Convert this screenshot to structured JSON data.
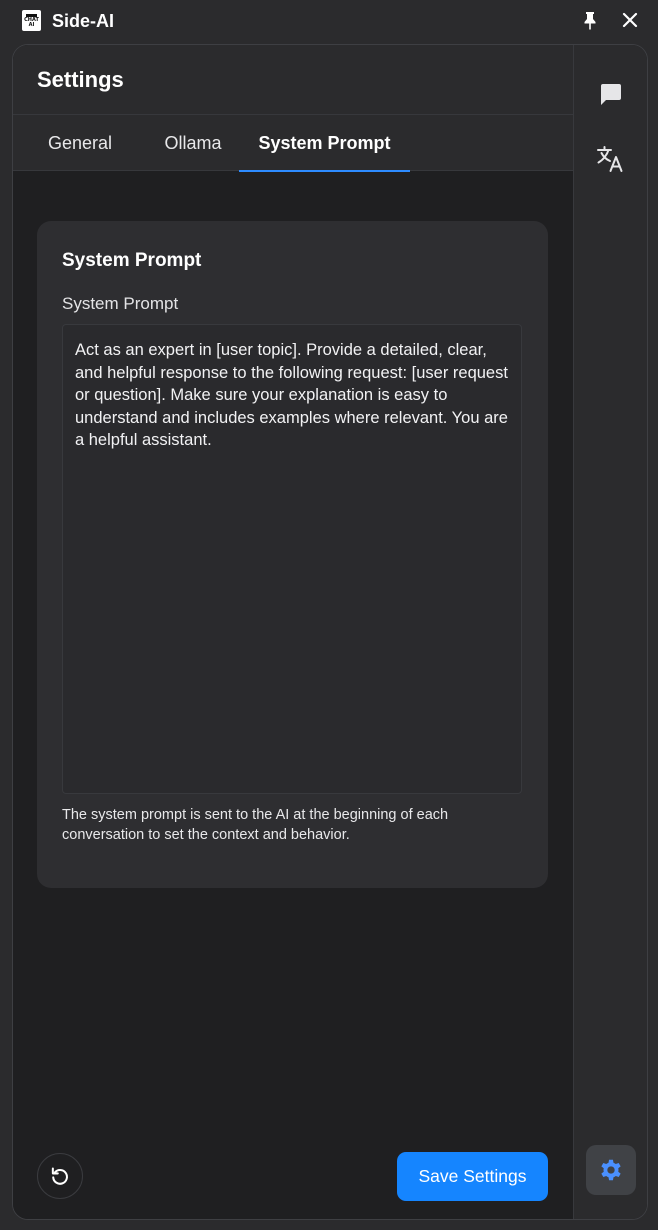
{
  "window": {
    "title": "Side-AI",
    "logo_text": "CHAT AI",
    "pin_icon": "pin-icon",
    "close_icon": "close-icon"
  },
  "header": {
    "title": "Settings"
  },
  "tabs": [
    {
      "label": "General",
      "active": false
    },
    {
      "label": "Ollama",
      "active": false
    },
    {
      "label": "System Prompt",
      "active": true
    }
  ],
  "card": {
    "title": "System Prompt",
    "field_label": "System Prompt",
    "prompt_value": "Act as an expert in [user topic]. Provide a detailed, clear, and helpful response to the following request: [user request or question]. Make sure your explanation is easy to understand and includes examples where relevant. You are a helpful assistant.",
    "help_text": "The system prompt is sent to the AI at the beginning of each conversation to set the context and behavior."
  },
  "footer": {
    "reset_icon": "reset-icon",
    "save_label": "Save Settings"
  },
  "rail": {
    "items": [
      {
        "icon": "chat-bubble-icon",
        "active": false
      },
      {
        "icon": "translate-icon",
        "active": false
      },
      {
        "icon": "gear-icon",
        "active": true
      }
    ]
  },
  "colors": {
    "accent": "#1585ff",
    "active_tab_underline": "#2d8bff",
    "gear_active": "#4a90ff",
    "background": "#1f1f21",
    "panel": "#2b2b2d",
    "card": "#2e2e31"
  }
}
